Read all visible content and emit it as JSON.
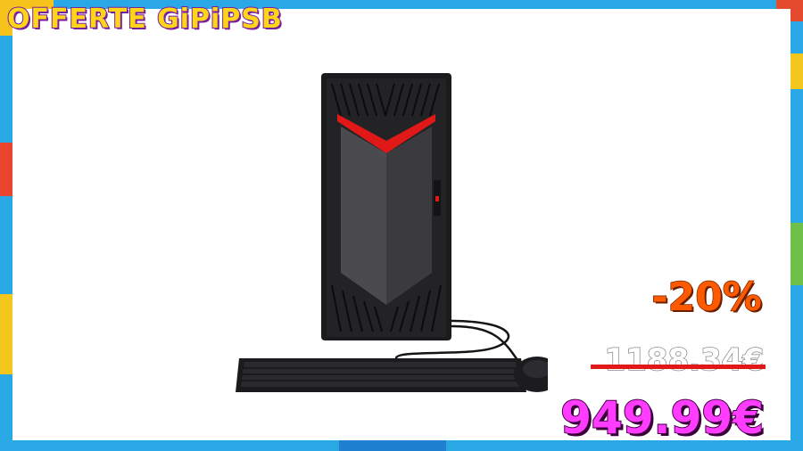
{
  "banner": {
    "brand": "OFFERTE GiPiPSB"
  },
  "product": {
    "image_label": "gaming-desktop-with-keyboard-and-mouse"
  },
  "pricing": {
    "discount": "-20%",
    "old_price": "1188.34€",
    "new_price": "949.99€"
  },
  "colors": {
    "frame": "#2aa8e6",
    "brand_text": "#ffd51a",
    "brand_outline": "#7a1ea0",
    "discount": "#ff5a00",
    "strike": "#e01818",
    "new_price": "#ff3cff",
    "case_accent": "#e01818"
  }
}
